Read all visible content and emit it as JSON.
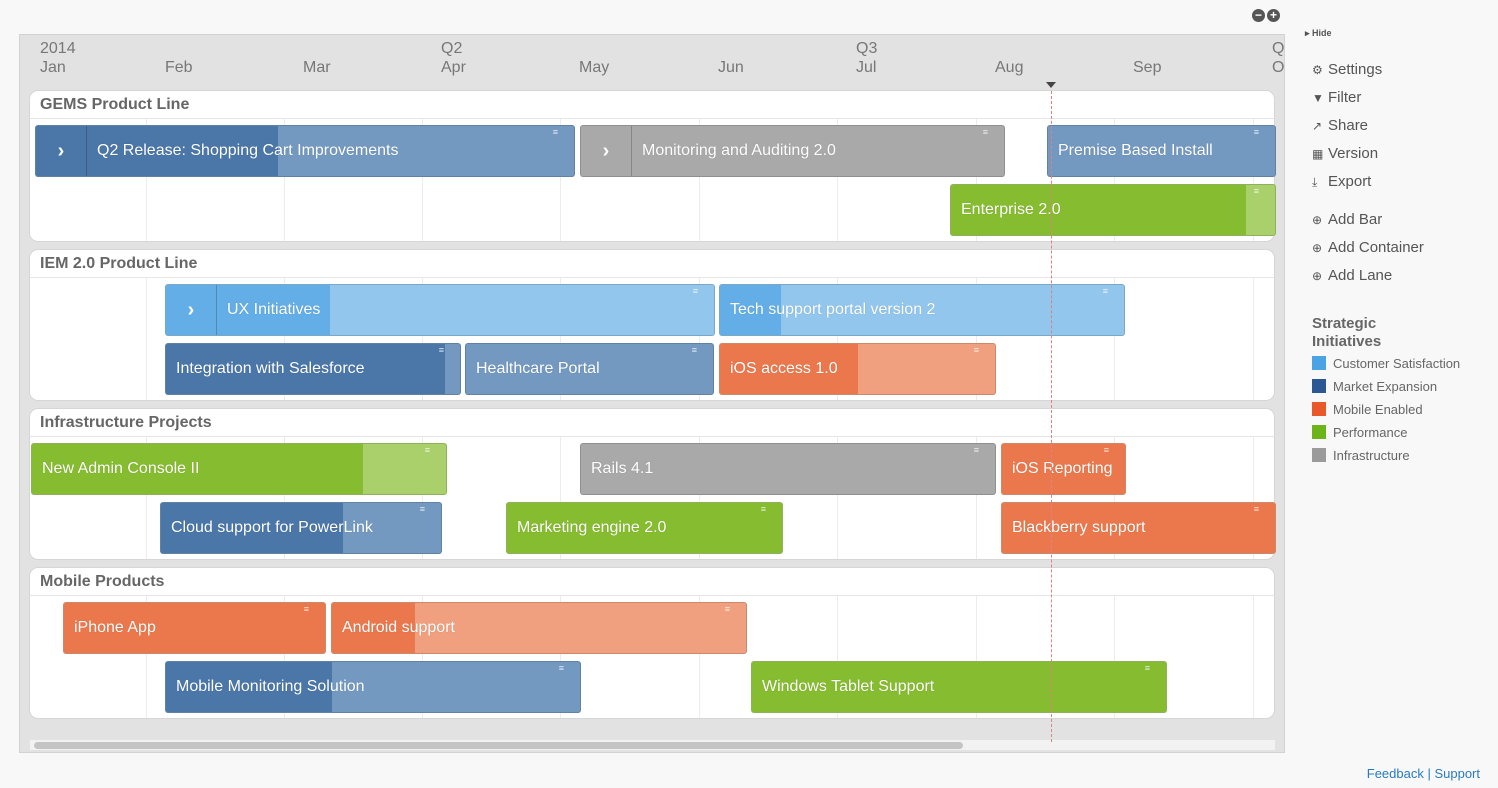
{
  "timeline": {
    "ticks": [
      {
        "top": "2014",
        "bottom": "Jan"
      },
      {
        "top": "",
        "bottom": "Feb"
      },
      {
        "top": "",
        "bottom": "Mar"
      },
      {
        "top": "Q2",
        "bottom": "Apr"
      },
      {
        "top": "",
        "bottom": "May"
      },
      {
        "top": "",
        "bottom": "Jun"
      },
      {
        "top": "Q3",
        "bottom": "Jul"
      },
      {
        "top": "",
        "bottom": "Aug"
      },
      {
        "top": "",
        "bottom": "Sep"
      },
      {
        "top": "Q",
        "bottom": "O"
      }
    ]
  },
  "zoom": {
    "out": "−",
    "in": "+"
  },
  "lanes": [
    {
      "title": "GEMS Product Line",
      "bars": [
        {
          "label": "Q2 Release: Shopping Cart Improvements",
          "initiative": "Market Expansion",
          "progress": 0.45,
          "container": true
        },
        {
          "label": "Monitoring and Auditing 2.0",
          "initiative": "Infrastructure",
          "progress": 0,
          "container": true
        },
        {
          "label": "Premise Based Install",
          "initiative": "Market Expansion",
          "progress": 0
        },
        {
          "label": "Enterprise 2.0",
          "initiative": "Performance",
          "progress": 0.91
        }
      ]
    },
    {
      "title": "IEM 2.0 Product Line",
      "bars": [
        {
          "label": "UX Initiatives",
          "initiative": "Customer Satisfaction",
          "progress": 0.3,
          "container": true
        },
        {
          "label": "Tech support portal version 2",
          "initiative": "Customer Satisfaction",
          "progress": 0.15
        },
        {
          "label": "Integration with Salesforce",
          "initiative": "Market Expansion",
          "progress": 0.95
        },
        {
          "label": "Healthcare Portal",
          "initiative": "Market Expansion",
          "progress": 0
        },
        {
          "label": "iOS access 1.0",
          "initiative": "Mobile Enabled",
          "progress": 0.5
        }
      ]
    },
    {
      "title": "Infrastructure Projects",
      "bars": [
        {
          "label": "New Admin Console II",
          "initiative": "Performance",
          "progress": 0.8
        },
        {
          "label": "Rails 4.1",
          "initiative": "Infrastructure",
          "progress": 1
        },
        {
          "label": "iOS Reporting",
          "initiative": "Mobile Enabled",
          "progress": 1
        },
        {
          "label": "Cloud support for PowerLink",
          "initiative": "Market Expansion",
          "progress": 0.65
        },
        {
          "label": "Marketing engine 2.0",
          "initiative": "Performance",
          "progress": 1
        },
        {
          "label": "Blackberry support",
          "initiative": "Mobile Enabled",
          "progress": 1
        }
      ]
    },
    {
      "title": "Mobile Products",
      "bars": [
        {
          "label": "iPhone App",
          "initiative": "Mobile Enabled",
          "progress": 1
        },
        {
          "label": "Android support",
          "initiative": "Mobile Enabled",
          "progress": 0.2
        },
        {
          "label": "Mobile Monitoring Solution",
          "initiative": "Market Expansion",
          "progress": 0.4
        },
        {
          "label": "Windows Tablet Support",
          "initiative": "Performance",
          "progress": 1
        }
      ]
    }
  ],
  "sidebar": {
    "hide": "Hide",
    "actions": [
      {
        "label": "Settings",
        "icon": "gear-icon",
        "glyph": "⚙"
      },
      {
        "label": "Filter",
        "icon": "filter-icon",
        "glyph": "▼"
      },
      {
        "label": "Share",
        "icon": "share-icon",
        "glyph": "↗"
      },
      {
        "label": "Version",
        "icon": "archive-icon",
        "glyph": "▦"
      },
      {
        "label": "Export",
        "icon": "download-icon",
        "glyph": "⤓"
      },
      {
        "label": "Add Bar",
        "icon": "plus-circle-icon",
        "glyph": "⊕"
      },
      {
        "label": "Add Container",
        "icon": "plus-circle-icon",
        "glyph": "⊕"
      },
      {
        "label": "Add Lane",
        "icon": "plus-circle-icon",
        "glyph": "⊕"
      }
    ],
    "legend_title": "Strategic Initiatives",
    "legend": [
      {
        "label": "Customer Satisfaction",
        "color": "#4ba3e3"
      },
      {
        "label": "Market Expansion",
        "color": "#2b5792"
      },
      {
        "label": "Mobile Enabled",
        "color": "#e8582a"
      },
      {
        "label": "Performance",
        "color": "#6db31a"
      },
      {
        "label": "Infrastructure",
        "color": "#9b9b9b"
      }
    ]
  },
  "bar_colors": {
    "Customer Satisfaction": {
      "done": "#63aee6",
      "rest": "#92c6ec"
    },
    "Market Expansion": {
      "done": "#4a76a8",
      "rest": "#7399c0"
    },
    "Mobile Enabled": {
      "done": "#ea784c",
      "rest": "#f0a07f"
    },
    "Performance": {
      "done": "#86bc2f",
      "rest": "#a9d06a"
    },
    "Infrastructure": {
      "done": "#a9a9a9",
      "rest": "#a9a9a9"
    }
  },
  "footer": {
    "feedback": "Feedback",
    "sep": " | ",
    "support": "Support"
  }
}
